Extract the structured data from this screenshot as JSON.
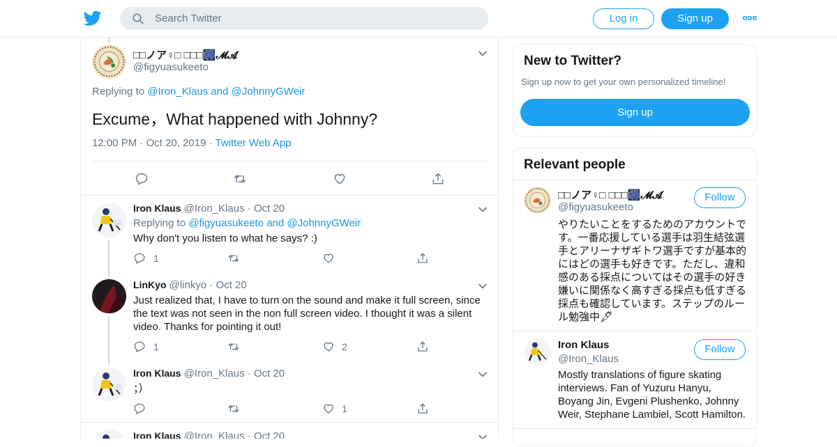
{
  "header": {
    "search_placeholder": "Search Twitter",
    "login_label": "Log in",
    "signup_label": "Sign up",
    "more_icon": "more-dots-icon"
  },
  "main_tweet": {
    "name": "□□ノア♀□ □□□🎆𝓜𝓐",
    "handle": "@figyuasukeeto",
    "replying_prefix": "Replying to",
    "replying_user1": "@Iron_Klaus",
    "replying_and": "and",
    "replying_user2": "@JohnnyGWeir",
    "text": "Excume，What happened with Johnny?",
    "time": "12:00 PM",
    "date": "Oct 20, 2019",
    "source": "Twitter Web App"
  },
  "replies": [
    {
      "name": "Iron Klaus",
      "handle": "@Iron_Klaus",
      "date": "Oct 20",
      "replying_prefix": "Replying to",
      "replying_user1": "@figyuasukeeto",
      "replying_and": "and",
      "replying_user2": "@JohnnyGWeir",
      "text": "Why don't you listen to what he says? :)",
      "reply_count": "1",
      "retweet_count": "",
      "like_count": ""
    },
    {
      "name": "LinKyo",
      "handle": "@linkyo",
      "date": "Oct 20",
      "text": "Just realized that, I have to turn on the sound and make it full screen, since the text was not seen in the non full screen video. I thought it was a silent video. Thanks for pointing it out!",
      "reply_count": "1",
      "retweet_count": "",
      "like_count": "2"
    },
    {
      "name": "Iron Klaus",
      "handle": "@Iron_Klaus",
      "date": "Oct 20",
      "text": "；）",
      "reply_count": "",
      "retweet_count": "",
      "like_count": "1"
    },
    {
      "name": "Iron Klaus",
      "handle": "@Iron_Klaus",
      "date": "Oct 20"
    }
  ],
  "sidebar": {
    "new_title": "New to Twitter?",
    "new_subtitle": "Sign up now to get your own personalized timeline!",
    "new_signup": "Sign up",
    "relevant_title": "Relevant people",
    "people": [
      {
        "name": "□□ノア♀□ □□□🎆𝓜𝓐",
        "handle": "@figyuasukeeto",
        "follow": "Follow",
        "bio": "やりたいことをするためのアカウントです。一番応援している選手は羽生結弦選手とアリーナザギトワ選手ですが基本的にはどの選手も好きです。ただし、違和感のある採点についてはその選手の好き嫌いに関係なく高すぎる採点も低すぎる採点も確認しています。ステップのルール勉強中🖋"
      },
      {
        "name": "Iron Klaus",
        "handle": "@Iron_Klaus",
        "follow": "Follow",
        "bio": "Mostly translations of figure skating interviews. Fan of Yuzuru Hanyu, Boyang Jin, Evgeni Plushenko, Johnny Weir, Stephane Lambiel, Scott Hamilton."
      }
    ]
  },
  "colors": {
    "accent": "#1da1f2",
    "link": "#1b95e0",
    "muted": "#657786",
    "border": "#e6ecf0"
  }
}
